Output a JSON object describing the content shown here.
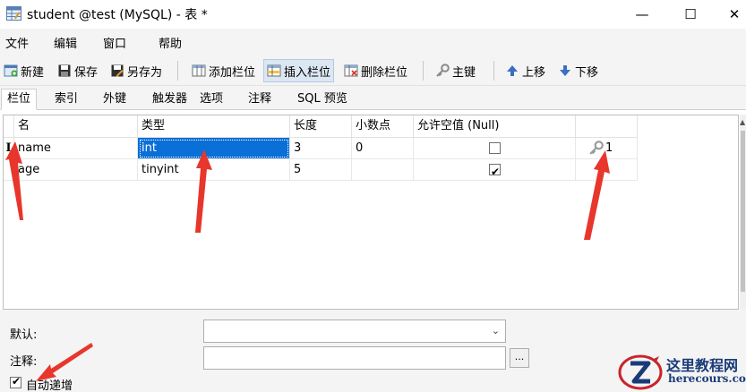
{
  "window": {
    "title": "student @test (MySQL) - 表 *",
    "minimize_glyph": "—",
    "maximize_glyph": "☐",
    "close_glyph": "✕"
  },
  "menu": [
    "文件",
    "编辑",
    "窗口",
    "帮助"
  ],
  "toolbar": {
    "new": "新建",
    "save": "保存",
    "save_as": "另存为",
    "add_column": "添加栏位",
    "insert_column": "插入栏位",
    "delete_column": "删除栏位",
    "primary_key": "主键",
    "move_up": "上移",
    "move_down": "下移"
  },
  "tabs": [
    "栏位",
    "索引",
    "外键",
    "触发器",
    "选项",
    "注释",
    "SQL 预览"
  ],
  "grid": {
    "headers": {
      "name": "名",
      "type": "类型",
      "length": "长度",
      "decimals": "小数点",
      "nullable": "允许空值 (Null)"
    },
    "rows": [
      {
        "marker": "I",
        "name": "name",
        "type": "int",
        "length": "3",
        "decimals": "0",
        "nullable": false,
        "key_order": "1"
      },
      {
        "marker": "",
        "name": "age",
        "type": "tinyint",
        "length": "5",
        "decimals": "",
        "nullable": true,
        "key_order": ""
      }
    ]
  },
  "properties": {
    "default_label": "默认:",
    "default_value": "",
    "comment_label": "注释:",
    "comment_value": "",
    "comment_button": "...",
    "auto_increment_label": "自动递增",
    "auto_increment_checked": true
  },
  "watermark": {
    "title": "这里教程网",
    "url": "herecours.com"
  },
  "colors": {
    "selection": "#0a6fd6",
    "annotation_arrow": "#e8362c",
    "watermark": "#1a3b78"
  }
}
